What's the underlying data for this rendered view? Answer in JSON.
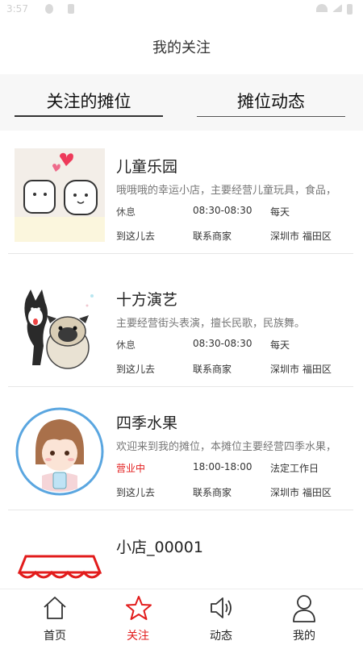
{
  "status_bar": {
    "time": "3:57"
  },
  "header": {
    "title": "我的关注"
  },
  "tabs": [
    {
      "label": "关注的摊位"
    },
    {
      "label": "摊位动态"
    }
  ],
  "stalls": [
    {
      "name": "儿童乐园",
      "description": "哦哦哦的幸运小店，主要经营儿童玩具，食品，",
      "status": "休息",
      "hours": "08:30-08:30",
      "days": "每天",
      "goto": "到这儿去",
      "contact": "联系商家",
      "address": "深圳市 福田区"
    },
    {
      "name": "十方演艺",
      "description": "主要经营街头表演，擅长民歌，民族舞。",
      "status": "休息",
      "hours": "08:30-08:30",
      "days": "每天",
      "goto": "到这儿去",
      "contact": "联系商家",
      "address": "深圳市 福田区"
    },
    {
      "name": "四季水果",
      "description": "欢迎来到我的摊位，本摊位主要经营四季水果，",
      "status": "营业中",
      "hours": "18:00-18:00",
      "days": "法定工作日",
      "goto": "到这儿去",
      "contact": "联系商家",
      "address": "深圳市 福田区"
    },
    {
      "name": "小店_00001"
    }
  ],
  "bottom_nav": [
    {
      "label": "首页",
      "icon": "home-icon"
    },
    {
      "label": "关注",
      "icon": "star-icon"
    },
    {
      "label": "动态",
      "icon": "speaker-icon"
    },
    {
      "label": "我的",
      "icon": "person-icon"
    }
  ],
  "colors": {
    "accent": "#e21b1b",
    "tab_bar_bg": "#f7f7f7",
    "separator": "#e6e6e6"
  }
}
